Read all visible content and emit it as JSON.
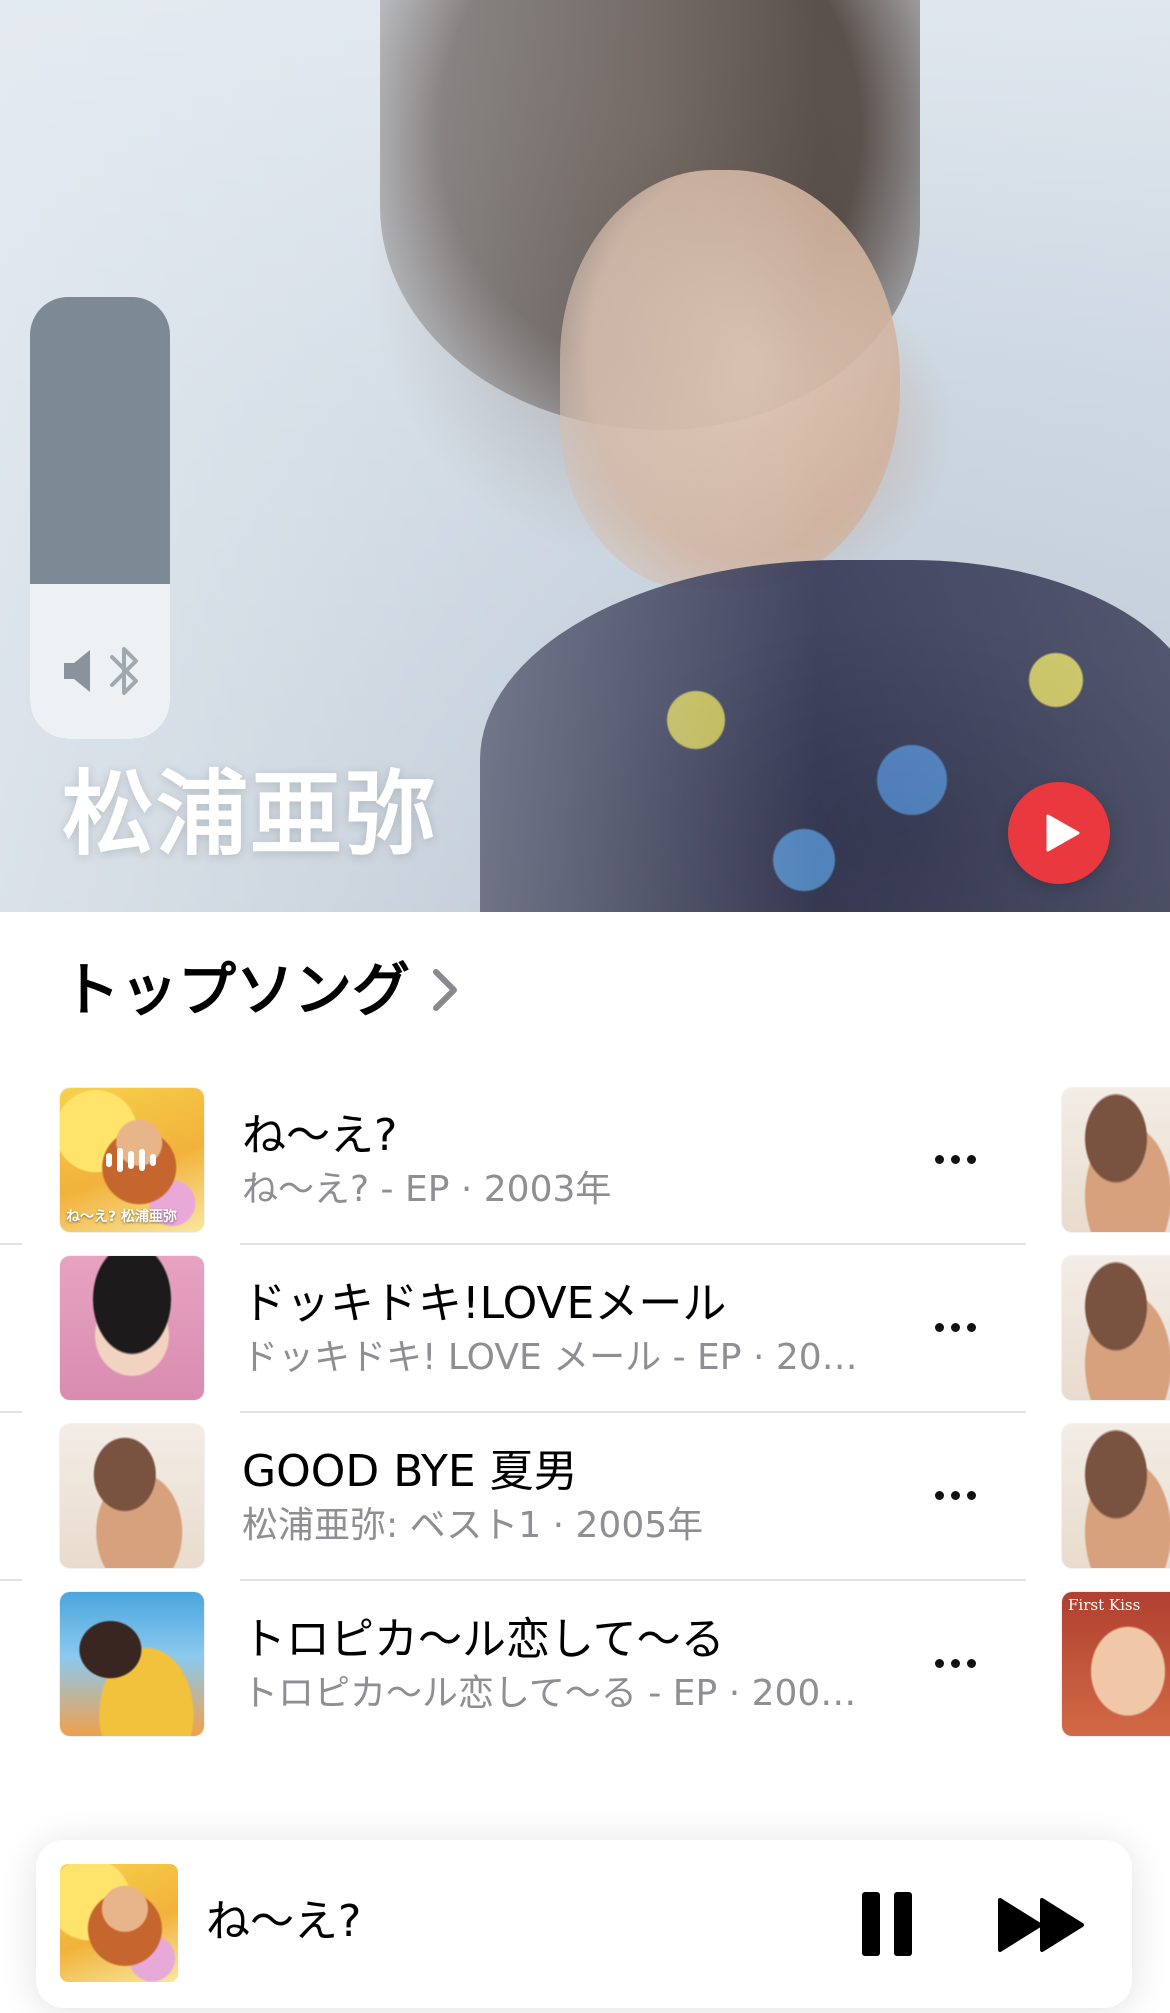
{
  "artist": {
    "name": "松浦亜弥"
  },
  "volume": {
    "level": 0.35
  },
  "section": {
    "title": "トップソング"
  },
  "songs": [
    {
      "title": "ね〜え?",
      "subtitle": "ね〜え? - EP · 2003年",
      "cover": "art-yellow",
      "playing": true
    },
    {
      "title": "ドッキドキ!LOVEメール",
      "subtitle": "ドッキドキ! LOVE メール - EP · 20…",
      "cover": "art-pink",
      "playing": false
    },
    {
      "title": "GOOD BYE 夏男",
      "subtitle": "松浦亜弥: ベスト1 · 2005年",
      "cover": "art-beige",
      "playing": false
    },
    {
      "title": "トロピカ〜ル恋して〜る",
      "subtitle": "トロピカ〜ル恋して〜る - EP · 200…",
      "cover": "art-tropical",
      "playing": false
    }
  ],
  "cover_text": {
    "yellow_caption": "ね〜え? 松浦亜弥",
    "peek_caption": "First Kiss"
  },
  "now_playing": {
    "title": "ね〜え?"
  },
  "colors": {
    "accent": "#e9393f",
    "secondary_text": "#8e8e93",
    "volume_track": "#7d8a96",
    "volume_fill": "#eef1f4"
  },
  "icons": {
    "play": "play-icon",
    "more": "ellipsis-icon",
    "chevron": "chevron-right-icon",
    "speaker": "speaker-icon",
    "bluetooth": "bluetooth-icon",
    "pause": "pause-icon",
    "next": "forward-icon"
  }
}
